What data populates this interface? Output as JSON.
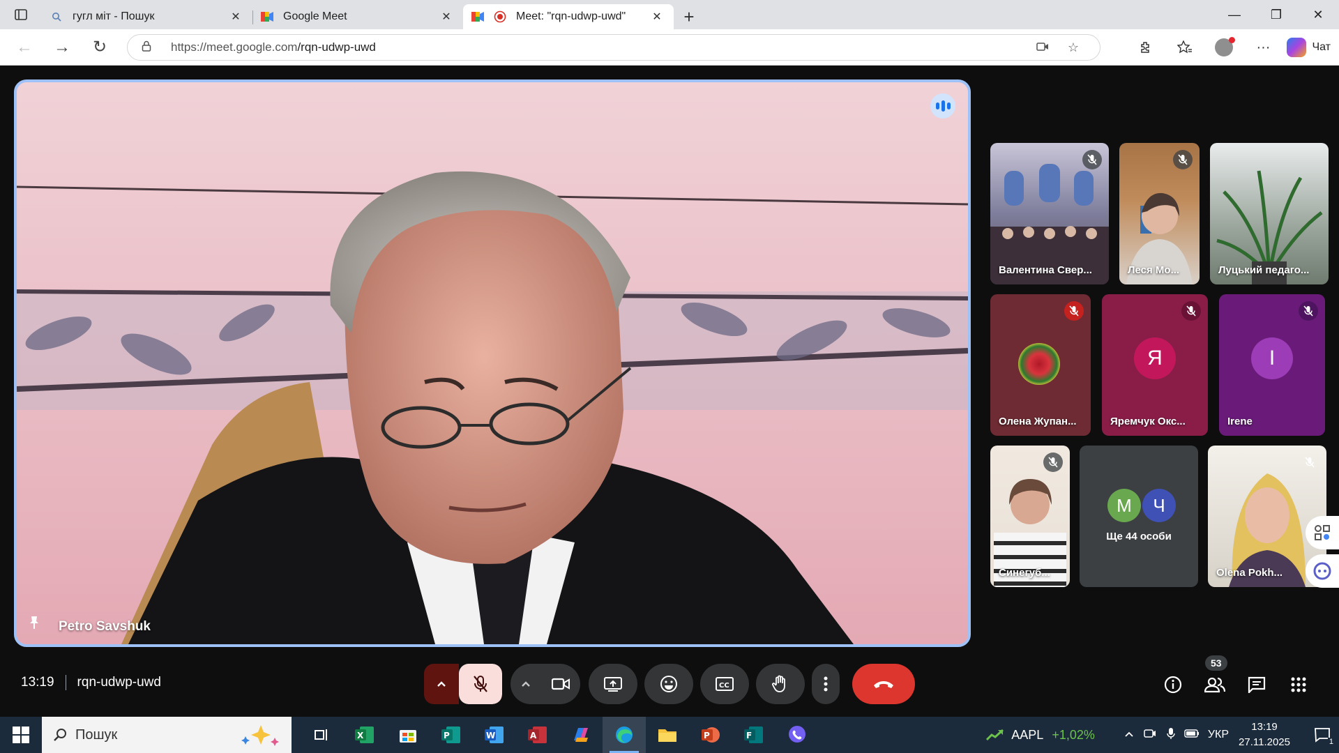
{
  "browser": {
    "tabs": [
      {
        "title": "гугл міт - Пошук",
        "icon": "search-icon"
      },
      {
        "title": "Google Meet",
        "icon": "google-meet-icon"
      },
      {
        "title": "Meet: \"rqn-udwp-uwd\"",
        "icon": "recording-icon"
      }
    ],
    "url_host": "https://meet.google.com",
    "url_path": "/rqn-udwp-uwd",
    "chat_label": "Чат"
  },
  "meet": {
    "speaker_name": "Petro Savshuk",
    "time": "13:19",
    "meeting_code": "rqn-udwp-uwd",
    "participants_count": "53",
    "tiles": [
      {
        "name": "Валентина Свер..."
      },
      {
        "name": "Леся Мо..."
      },
      {
        "name": "Луцький педаго..."
      },
      {
        "name": "Олена Жупан..."
      },
      {
        "name": "Яремчук Окс...",
        "letter": "Я"
      },
      {
        "name": "Irene",
        "letter": "I"
      },
      {
        "name": "Синегуб..."
      },
      {
        "name": "Ще 44 особи",
        "letters": [
          "М",
          "Ч"
        ]
      },
      {
        "name": "Olena Pokh..."
      }
    ]
  },
  "taskbar": {
    "search_label": "Пошук",
    "stock_ticker": "AAPL",
    "stock_change": "+1,02%",
    "language": "УКР",
    "time": "13:19",
    "date": "27.11.2025",
    "notifications": "1"
  },
  "colors": {
    "end_call": "#dc362e",
    "speaker_border": "#9ec1f7",
    "mic_off_bg": "#f9dedc",
    "meet_bg": "#0e0e0e"
  }
}
